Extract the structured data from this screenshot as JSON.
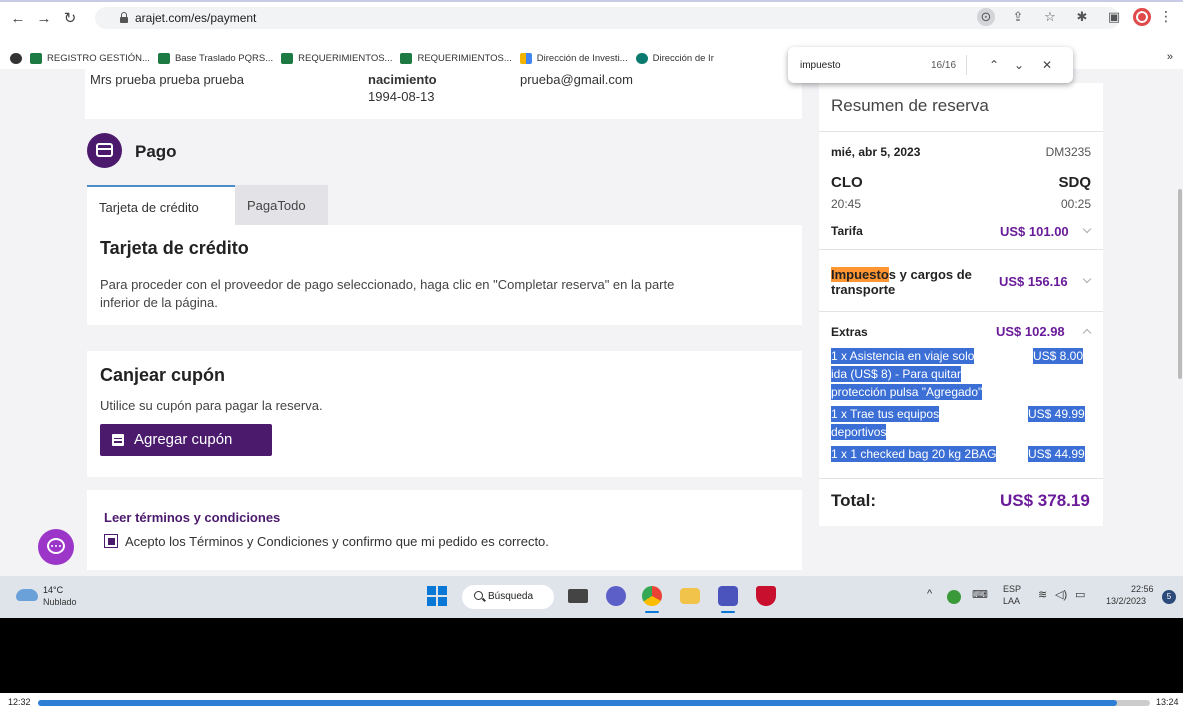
{
  "browser": {
    "url": "arajet.com/es/payment",
    "bookmarks": [
      "REGISTRO GESTIÓN...",
      "Base Traslado PQRS...",
      "REQUERIMIENTOS...",
      "REQUERIMIENTOS...",
      "Dirección de Investi...",
      "Dirección de Ir"
    ],
    "more": "»"
  },
  "findbar": {
    "query": "impuesto",
    "count": "16/16"
  },
  "passenger": {
    "name": "Mrs prueba prueba prueba",
    "dob_label": "nacimiento",
    "dob": "1994-08-13",
    "email": "prueba@gmail.com"
  },
  "payment": {
    "title": "Pago",
    "tabs": [
      "Tarjeta de crédito",
      "PagaTodo"
    ],
    "card_title": "Tarjeta de crédito",
    "card_text_1": "Para proceder con el proveedor de pago seleccionado, haga clic en \"Completar reserva\" en la parte",
    "card_text_2": "inferior de la página."
  },
  "coupon": {
    "title": "Canjear cupón",
    "text": "Utilice su cupón para pagar la reserva.",
    "button": "Agregar cupón"
  },
  "terms": {
    "title": "Leer términos y condiciones",
    "text": "Acepto los Términos y Condiciones y confirmo que mi pedido es correcto."
  },
  "summary": {
    "title": "Resumen de reserva",
    "date": "mié, abr 5, 2023",
    "flight": "DM3235",
    "origin": "CLO",
    "destination": "SDQ",
    "dep_time": "20:45",
    "arr_time": "00:25",
    "fare_label": "Tarifa",
    "fare": "US$ 101.00",
    "tax_highlight": "Impuesto",
    "tax_label_rest": "s y cargos de",
    "tax_label_2": "transporte",
    "tax": "US$ 156.16",
    "extras_label": "Extras",
    "extras": "US$ 102.98",
    "extra_items": [
      {
        "l1": "1 x Asistencia en viaje solo",
        "l2": "ida (US$ 8) - Para quitar",
        "l3": "protección pulsa \"Agregado\"",
        "price": "US$ 8.00"
      },
      {
        "l1": "1 x Trae tus equipos",
        "l2": "deportivos",
        "price": "US$ 49.99"
      },
      {
        "l1": "1 x 1 checked bag 20 kg 2BAG",
        "price": "US$ 44.99"
      }
    ],
    "total_label": "Total:",
    "total": "US$ 378.19"
  },
  "taskbar": {
    "temp": "14°C",
    "weather": "Nublado",
    "search": "Búsqueda",
    "lang1": "ESP",
    "lang2": "LAA",
    "time": "22:56",
    "date": "13/2/2023",
    "notifications": "5"
  },
  "video": {
    "current": "12:32",
    "total": "13:24",
    "progress": 0.97
  }
}
